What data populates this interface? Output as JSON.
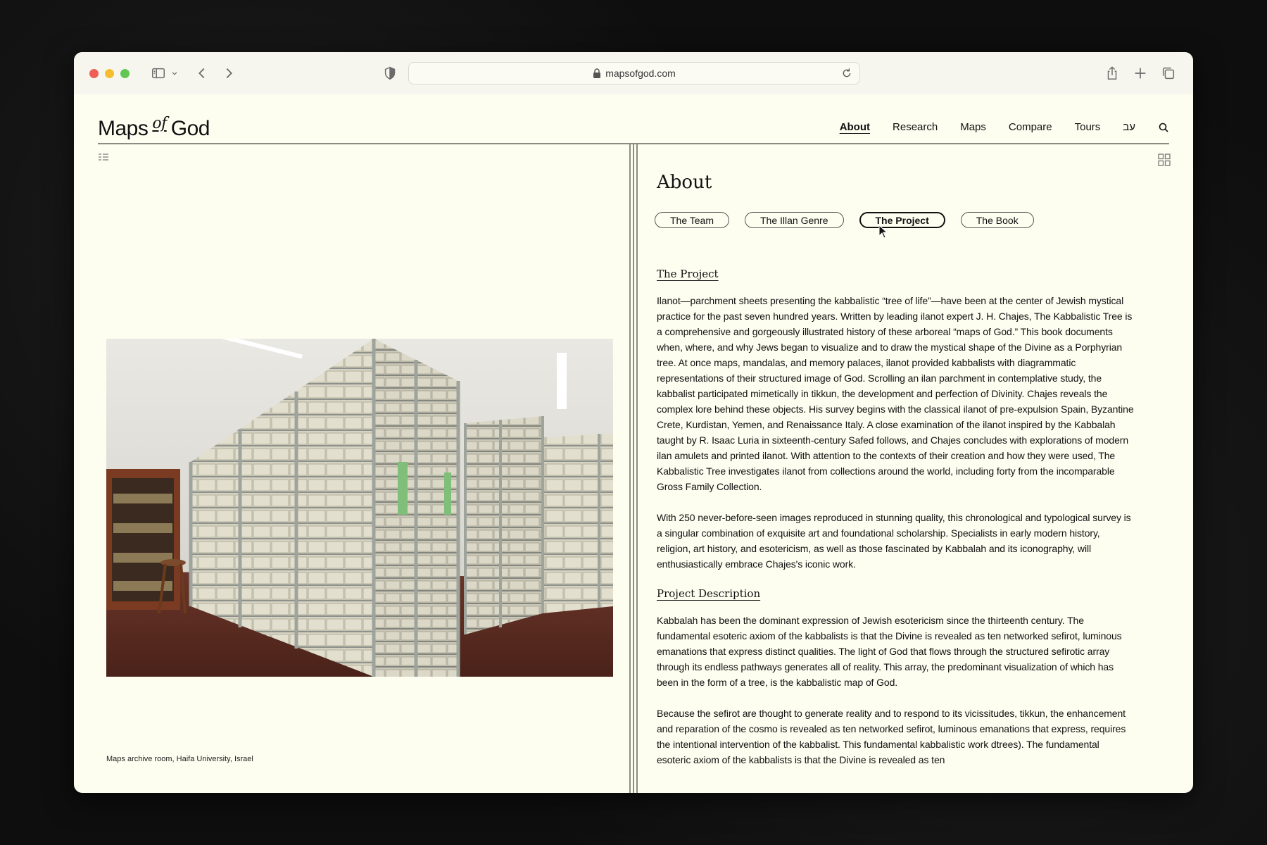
{
  "browser": {
    "url": "mapsofgod.com"
  },
  "site": {
    "logo_main": "Maps",
    "logo_of": "of",
    "logo_end": "God",
    "nav": [
      {
        "label": "About",
        "active": true
      },
      {
        "label": "Research"
      },
      {
        "label": "Maps"
      },
      {
        "label": "Compare"
      },
      {
        "label": "Tours"
      },
      {
        "label": "עב"
      }
    ]
  },
  "left": {
    "caption": "Maps archive room, Haifa University, Israel"
  },
  "right": {
    "title": "About",
    "pills": [
      {
        "label": "The Team"
      },
      {
        "label": "The Illan Genre"
      },
      {
        "label": "The Project",
        "active": true
      },
      {
        "label": "The Book"
      }
    ],
    "section1_heading": "The Project",
    "para1": "Ilanot—parchment sheets presenting the kabbalistic “tree of life”—have been at the center of Jewish mystical practice for the past seven hundred years. Written by leading ilanot expert J. H. Chajes, The Kabbalistic Tree is a comprehensive and gorgeously illustrated history of these arboreal “maps of God.” This book documents when, where, and why Jews began to visualize and to draw the mystical shape of the Divine as a Porphyrian tree. At once maps, mandalas, and memory palaces, ilanot provided kabbalists with diagrammatic representations of their structured image of God. Scrolling an ilan parchment in contemplative study, the kabbalist participated mimetically in tikkun, the development and perfection of Divinity. Chajes reveals the complex lore behind these objects. His survey begins with the classical ilanot of pre-expulsion Spain, Byzantine Crete, Kurdistan, Yemen, and Renaissance Italy. A close examination of the ilanot inspired by the Kabbalah taught by R. Isaac Luria in sixteenth-century Safed follows, and Chajes concludes with explorations of modern ilan amulets and printed ilanot. With attention to the contexts of their creation and how they were used, The Kabbalistic Tree investigates ilanot from collections around the world, including forty from the incomparable Gross Family Collection.",
    "para2": "With 250 never-before-seen images reproduced in stunning quality, this chronological and typological survey is a singular combination of exquisite art and foundational scholarship. Specialists in early modern history, religion, art history, and esotericism, as well as those fascinated by Kabbalah and its iconography, will enthusiastically embrace Chajes's iconic work.",
    "section2_heading": "Project Description",
    "para3": "Kabbalah has been the dominant expression of Jewish esotericism since the thirteenth century. The fundamental esoteric axiom of the kabbalists is that the Divine is revealed as ten networked sefirot, luminous emanations that express distinct qualities. The light of God that flows through the structured sefirotic array through its endless pathways generates all of reality. This array, the predominant visualization of which has been in the form of a tree, is the kabbalistic map of God.",
    "para4": "Because the sefirot are thought to generate reality and to respond to its vicissitudes, tikkun, the enhancement and reparation of the cosmo is revealed as ten networked sefirot, luminous emanations that express, requires the intentional intervention of the kabbalist. This fundamental kabbalistic work dtrees). The fundamental esoteric axiom of the kabbalists is that the Divine is revealed as ten"
  },
  "colors": {
    "page_bg": "#fdfdf0",
    "outer_bg": "#0e0e0e",
    "rule": "#8c8c84"
  }
}
